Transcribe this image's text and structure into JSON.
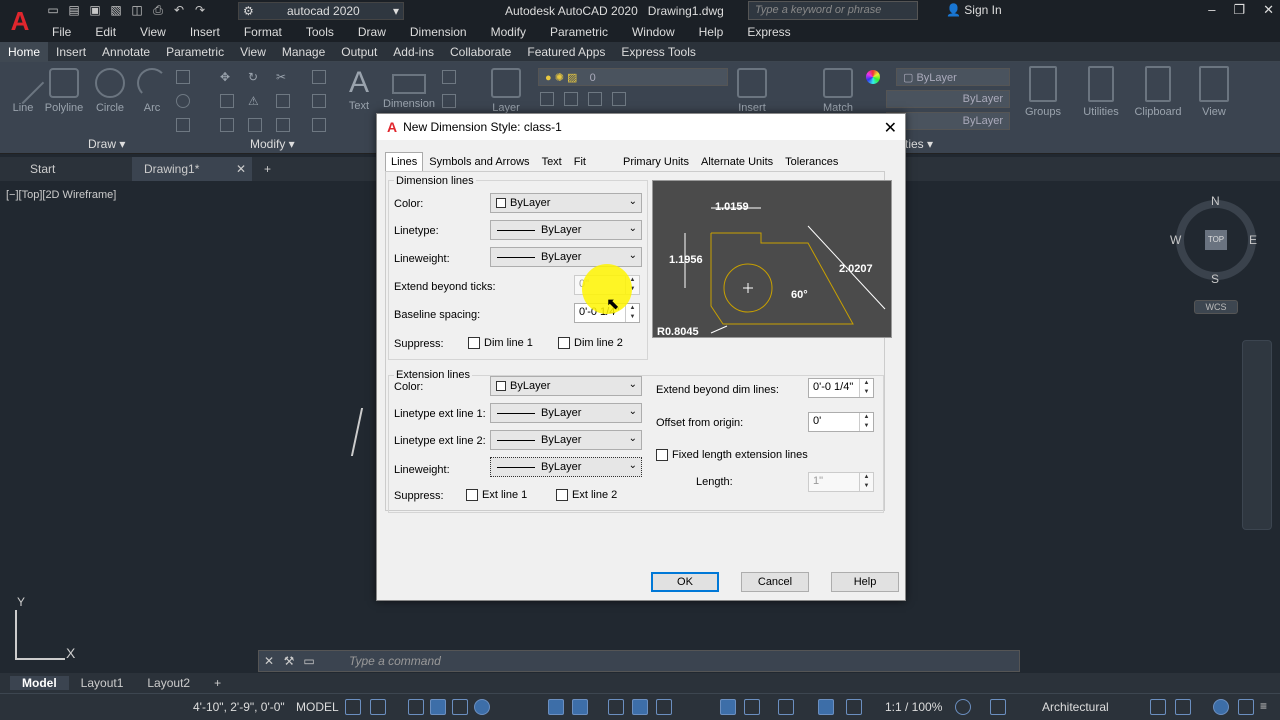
{
  "app": {
    "title": "Autodesk AutoCAD 2020",
    "document": "Drawing1.dwg",
    "workspace": "autocad 2020",
    "search_placeholder": "Type a keyword or phrase",
    "signin": "Sign In",
    "logo": "A"
  },
  "menu": [
    "File",
    "Edit",
    "View",
    "Insert",
    "Format",
    "Tools",
    "Draw",
    "Dimension",
    "Modify",
    "Parametric",
    "Window",
    "Help",
    "Express"
  ],
  "ribbon_tabs": [
    "Home",
    "Insert",
    "Annotate",
    "Parametric",
    "View",
    "Manage",
    "Output",
    "Add-ins",
    "Collaborate",
    "Featured Apps",
    "Express Tools"
  ],
  "ribbon": {
    "draw_tools": [
      "Line",
      "Polyline",
      "Circle",
      "Arc"
    ],
    "text": "Text",
    "dimension": "Dimension",
    "layer": "Layer",
    "insert": "Insert",
    "match": "Match",
    "groups": "Groups",
    "utilities": "Utilities",
    "clipboard": "Clipboard",
    "view": "View",
    "panel_draw": "Draw",
    "panel_modify": "Modify",
    "panel_properties": "ties",
    "layer_value": "0",
    "prop_color": "ByLayer",
    "prop_linetype": "ByLayer",
    "prop_lineweight": "ByLayer"
  },
  "file_tabs": {
    "start": "Start",
    "drawing": "Drawing1*"
  },
  "viewport": {
    "label": "[−][Top][2D Wireframe]",
    "cube_top": "TOP",
    "n": "N",
    "s": "S",
    "e": "E",
    "w": "W",
    "wcs": "WCS",
    "ucs_x": "X",
    "ucs_y": "Y"
  },
  "command": {
    "placeholder": "Type a command"
  },
  "layout_tabs": [
    "Model",
    "Layout1",
    "Layout2"
  ],
  "status": {
    "coords": "4'-10\", 2'-9\", 0'-0\"",
    "model": "MODEL",
    "scale": "1:1 / 100%",
    "units": "Architectural"
  },
  "dialog": {
    "title": "New Dimension Style: class-1",
    "tabs": [
      "Lines",
      "Symbols and Arrows",
      "Text",
      "Fit",
      "Primary Units",
      "Alternate Units",
      "Tolerances"
    ],
    "dimension_lines": {
      "group": "Dimension lines",
      "color_label": "Color:",
      "color": "ByLayer",
      "linetype_label": "Linetype:",
      "linetype": "ByLayer",
      "lineweight_label": "Lineweight:",
      "lineweight": "ByLayer",
      "extend_label": "Extend beyond ticks:",
      "extend": "0\"",
      "baseline_label": "Baseline spacing:",
      "baseline": "0'-0 1/4\"",
      "suppress_label": "Suppress:",
      "dim1": "Dim line 1",
      "dim2": "Dim line 2"
    },
    "extension_lines": {
      "group": "Extension lines",
      "color_label": "Color:",
      "color": "ByLayer",
      "lt1_label": "Linetype ext line 1:",
      "lt1": "ByLayer",
      "lt2_label": "Linetype ext line 2:",
      "lt2": "ByLayer",
      "lineweight_label": "Lineweight:",
      "lineweight": "ByLayer",
      "suppress_label": "Suppress:",
      "ext1": "Ext line 1",
      "ext2": "Ext line 2",
      "extend_dim_label": "Extend beyond dim lines:",
      "extend_dim": "0'-0 1/4\"",
      "offset_label": "Offset from origin:",
      "offset": "0'",
      "fixed_label": "Fixed length extension lines",
      "length_label": "Length:",
      "length": "1\""
    },
    "preview": {
      "d1": "1.0159",
      "d2": "1.1956",
      "d3": "2.0207",
      "angle": "60°",
      "radius": "R0.8045"
    },
    "buttons": {
      "ok": "OK",
      "cancel": "Cancel",
      "help": "Help"
    }
  }
}
